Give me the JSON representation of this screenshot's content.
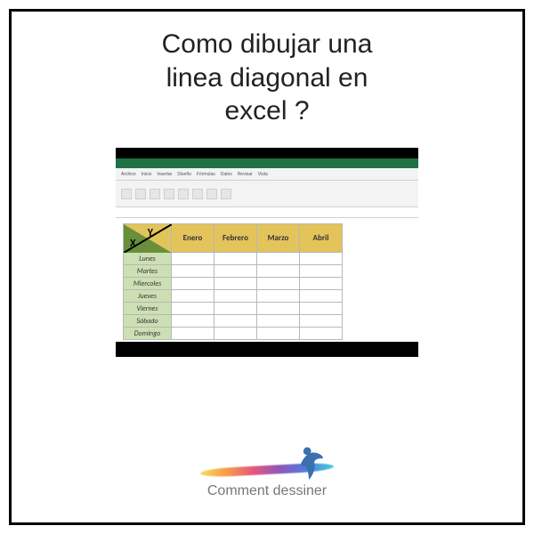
{
  "title": {
    "line1": "Como dibujar una",
    "line2": "linea diagonal en",
    "line3": "excel ?"
  },
  "excel": {
    "ribbon_tabs": [
      "Archivo",
      "Inicio",
      "Insertar",
      "Diseño",
      "Fórmulas",
      "Datos",
      "Revisar",
      "Vista"
    ],
    "corner": {
      "x": "X",
      "y": "Y"
    },
    "months": [
      "Enero",
      "Febrero",
      "Marzo",
      "Abril"
    ],
    "days": [
      "Lunes",
      "Martes",
      "Miercoles",
      "Jueves",
      "Viernes",
      "Sábado",
      "Domingo"
    ]
  },
  "brand": {
    "name": "Comment dessiner"
  }
}
